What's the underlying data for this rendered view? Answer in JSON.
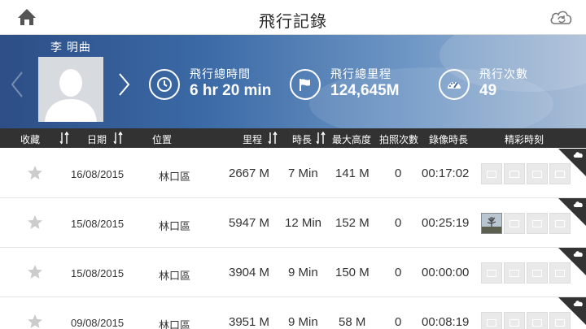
{
  "header": {
    "title": "飛行記錄",
    "home_icon": "home-icon",
    "sync_icon": "cloud-sync-icon"
  },
  "profile": {
    "name": "李 明曲",
    "stats": [
      {
        "icon": "clock-icon",
        "label": "飛行總時間",
        "value": "6 hr 20 min"
      },
      {
        "icon": "flag-icon",
        "label": "飛行總里程",
        "value": "124,645M"
      },
      {
        "icon": "speedometer-icon",
        "label": "飛行次數",
        "value": "49"
      }
    ]
  },
  "columns": {
    "favorite": "收藏",
    "date": "日期",
    "location": "位置",
    "distance": "里程",
    "duration": "時長",
    "max_altitude": "最大高度",
    "photo_count": "拍照次數",
    "video_duration": "錄像時長",
    "highlights": "精彩時刻"
  },
  "rows": [
    {
      "date": "16/08/2015",
      "location": "林口區",
      "distance": "2667 M",
      "duration": "7 Min",
      "max_altitude": "141 M",
      "photos": "0",
      "video": "00:17:02",
      "has_photo_thumb": false
    },
    {
      "date": "15/08/2015",
      "location": "林口區",
      "distance": "5947 M",
      "duration": "12 Min",
      "max_altitude": "152 M",
      "photos": "0",
      "video": "00:25:19",
      "has_photo_thumb": true
    },
    {
      "date": "15/08/2015",
      "location": "林口區",
      "distance": "3904 M",
      "duration": "9 Min",
      "max_altitude": "150 M",
      "photos": "0",
      "video": "00:00:00",
      "has_photo_thumb": false
    },
    {
      "date": "09/08/2015",
      "location": "林口區",
      "distance": "3951 M",
      "duration": "9 Min",
      "max_altitude": "58 M",
      "photos": "0",
      "video": "00:08:19",
      "has_photo_thumb": false
    }
  ],
  "colors": {
    "header_bar": "#323232",
    "banner_left": "#2d4e86",
    "banner_right": "#a9bdd6",
    "corner_tag": "#333333",
    "star": "#cccccc"
  }
}
